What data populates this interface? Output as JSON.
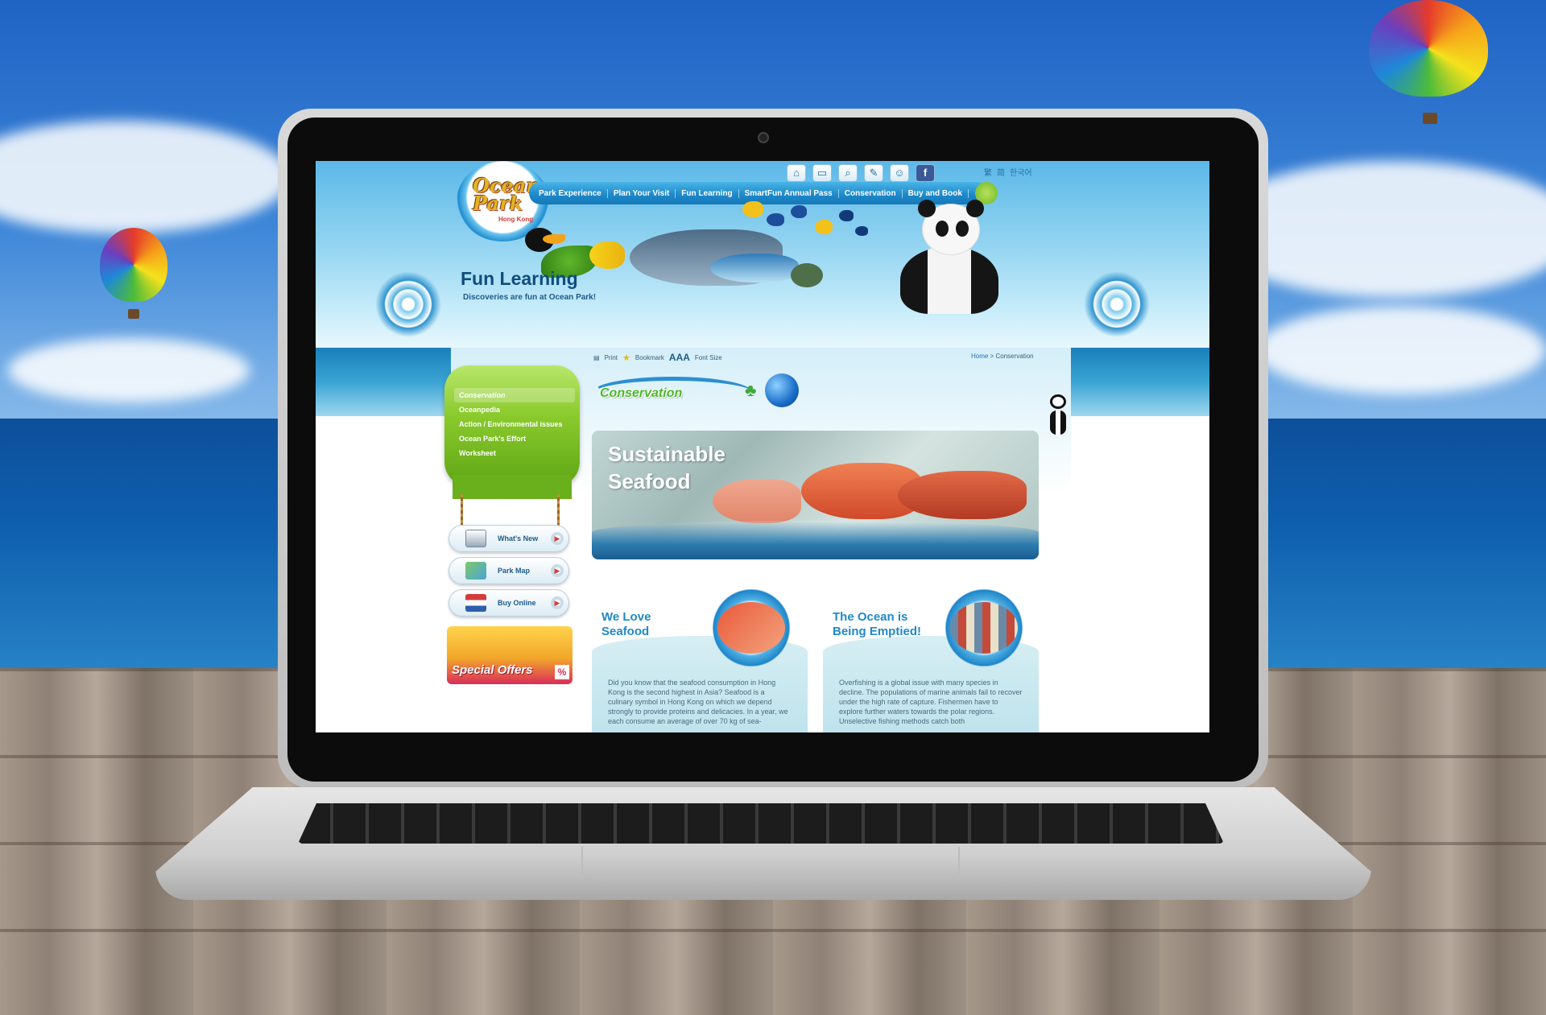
{
  "site": {
    "logo_text": "Ocean Park",
    "logo_sub": "Hong Kong",
    "languages": [
      "繁",
      "简",
      "한국어"
    ],
    "nav": [
      "Park Experience",
      "Plan Your Visit",
      "Fun Learning",
      "SmartFun Annual Pass",
      "Conservation",
      "Buy and Book"
    ],
    "toolbar_icons": [
      "home-icon",
      "ticket-icon",
      "search-icon",
      "edit-icon",
      "user-icon",
      "facebook-icon"
    ]
  },
  "header": {
    "title": "Fun Learning",
    "subtitle": "Discoveries are fun at Ocean Park!"
  },
  "utility": {
    "print": "Print",
    "bookmark": "Bookmark",
    "font_size_sample": "AAA",
    "font_size": "Font Size",
    "breadcrumb_home": "Home",
    "breadcrumb_sep": ">",
    "breadcrumb_current": "Conservation"
  },
  "sidebar": {
    "menu": [
      "Conservation",
      "Oceanpedia",
      "Action / Environmental issues",
      "Ocean Park's Effort",
      "Worksheet"
    ],
    "buttons": [
      {
        "label": "What's New",
        "icon": "news-icon"
      },
      {
        "label": "Park Map",
        "icon": "map-icon"
      },
      {
        "label": "Buy Online",
        "icon": "ticket-icon"
      }
    ],
    "offers_label": "Special Offers",
    "offers_pct": "%"
  },
  "main": {
    "section_title": "Conservation",
    "hero_title_1": "Sustainable",
    "hero_title_2": "Seafood",
    "cards": [
      {
        "title_1": "We Love",
        "title_2": "Seafood",
        "text": "Did you know that the seafood consumption in Hong Kong is the second highest in Asia? Seafood is a culinary symbol in Hong Kong on which we depend strongly to provide proteins and delicacies. In a year, we each consume an average of over 70 kg of sea-"
      },
      {
        "title_1": "The Ocean is",
        "title_2": "Being Emptied!",
        "text": "Overfishing is a global issue with many species in decline. The populations of marine animals fail to recover under the high rate of capture. Fishermen have to explore further waters towards the polar regions. Unselective fishing methods catch both"
      }
    ]
  },
  "colors": {
    "nav_blue": "#1c87c9",
    "menu_green": "#8ccb2e",
    "title_blue": "#0f4d7e",
    "card_title_blue": "#1f88c9"
  }
}
